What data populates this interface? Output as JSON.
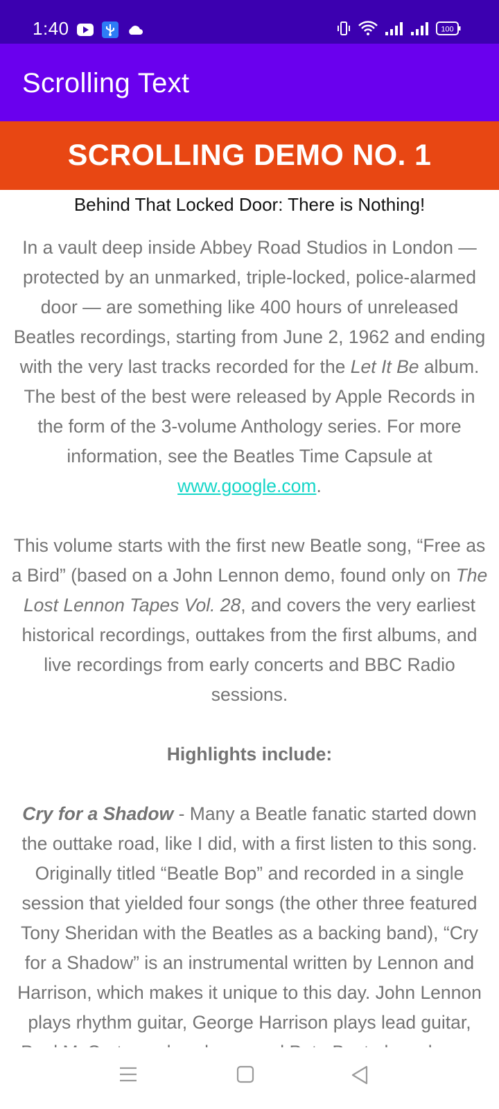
{
  "status_bar": {
    "time": "1:40",
    "battery": "100",
    "left_icons": [
      "youtube-icon",
      "usb-icon",
      "cloud-icon"
    ],
    "right_icons": [
      "vibrate-icon",
      "wifi-icon",
      "signal-icon",
      "signal-icon",
      "battery-icon"
    ]
  },
  "app_bar": {
    "title": "Scrolling Text"
  },
  "banner": {
    "text": "SCROLLING DEMO NO. 1"
  },
  "subtitle": "Behind That Locked Door: There is Nothing!",
  "article": {
    "p1_a": "In a vault deep inside Abbey Road Studios in London — protected by an unmarked, triple-locked, police-alarmed door — are something like 400 hours of unreleased Beatles recordings, starting from June 2, 1962 and ending with the very last tracks recorded for the ",
    "p1_italic": "Let It Be",
    "p1_b": " album. The best of the best were released by Apple Records in the form of the 3-volume Anthology series. For more information, see the Beatles Time Capsule at ",
    "p1_link": "www.google.com",
    "p1_end": ".",
    "p2_a": "This volume starts with the first new Beatle song, “Free as a Bird” (based on a John Lennon demo, found only on ",
    "p2_italic": "The Lost Lennon Tapes Vol. 28",
    "p2_b": ", and covers the very earliest historical recordings, outtakes from the first albums, and live recordings from early concerts and BBC Radio sessions.",
    "highlights_title": "Highlights include:",
    "p3_title": "Cry for a Shadow",
    "p3_body": " - Many a Beatle fanatic started down the outtake road, like I did, with a first listen to this song. Originally titled “Beatle Bop” and recorded in a single session that yielded four songs (the other three featured Tony Sheridan with the Beatles as a backing band), “Cry for a Shadow” is an instrumental written by Lennon and Harrison, which makes it unique to this day. John Lennon plays rhythm guitar, George Harrison plays lead guitar, Paul McCartney plays bass, and Pete Best plays drums."
  },
  "nav_bar": {
    "items": [
      "menu-icon",
      "home-icon",
      "back-icon"
    ]
  },
  "colors": {
    "status_bar": "#3c00b0",
    "app_bar": "#6a00ee",
    "banner": "#e84713",
    "link": "#16d6c8",
    "body_text": "#737373"
  }
}
